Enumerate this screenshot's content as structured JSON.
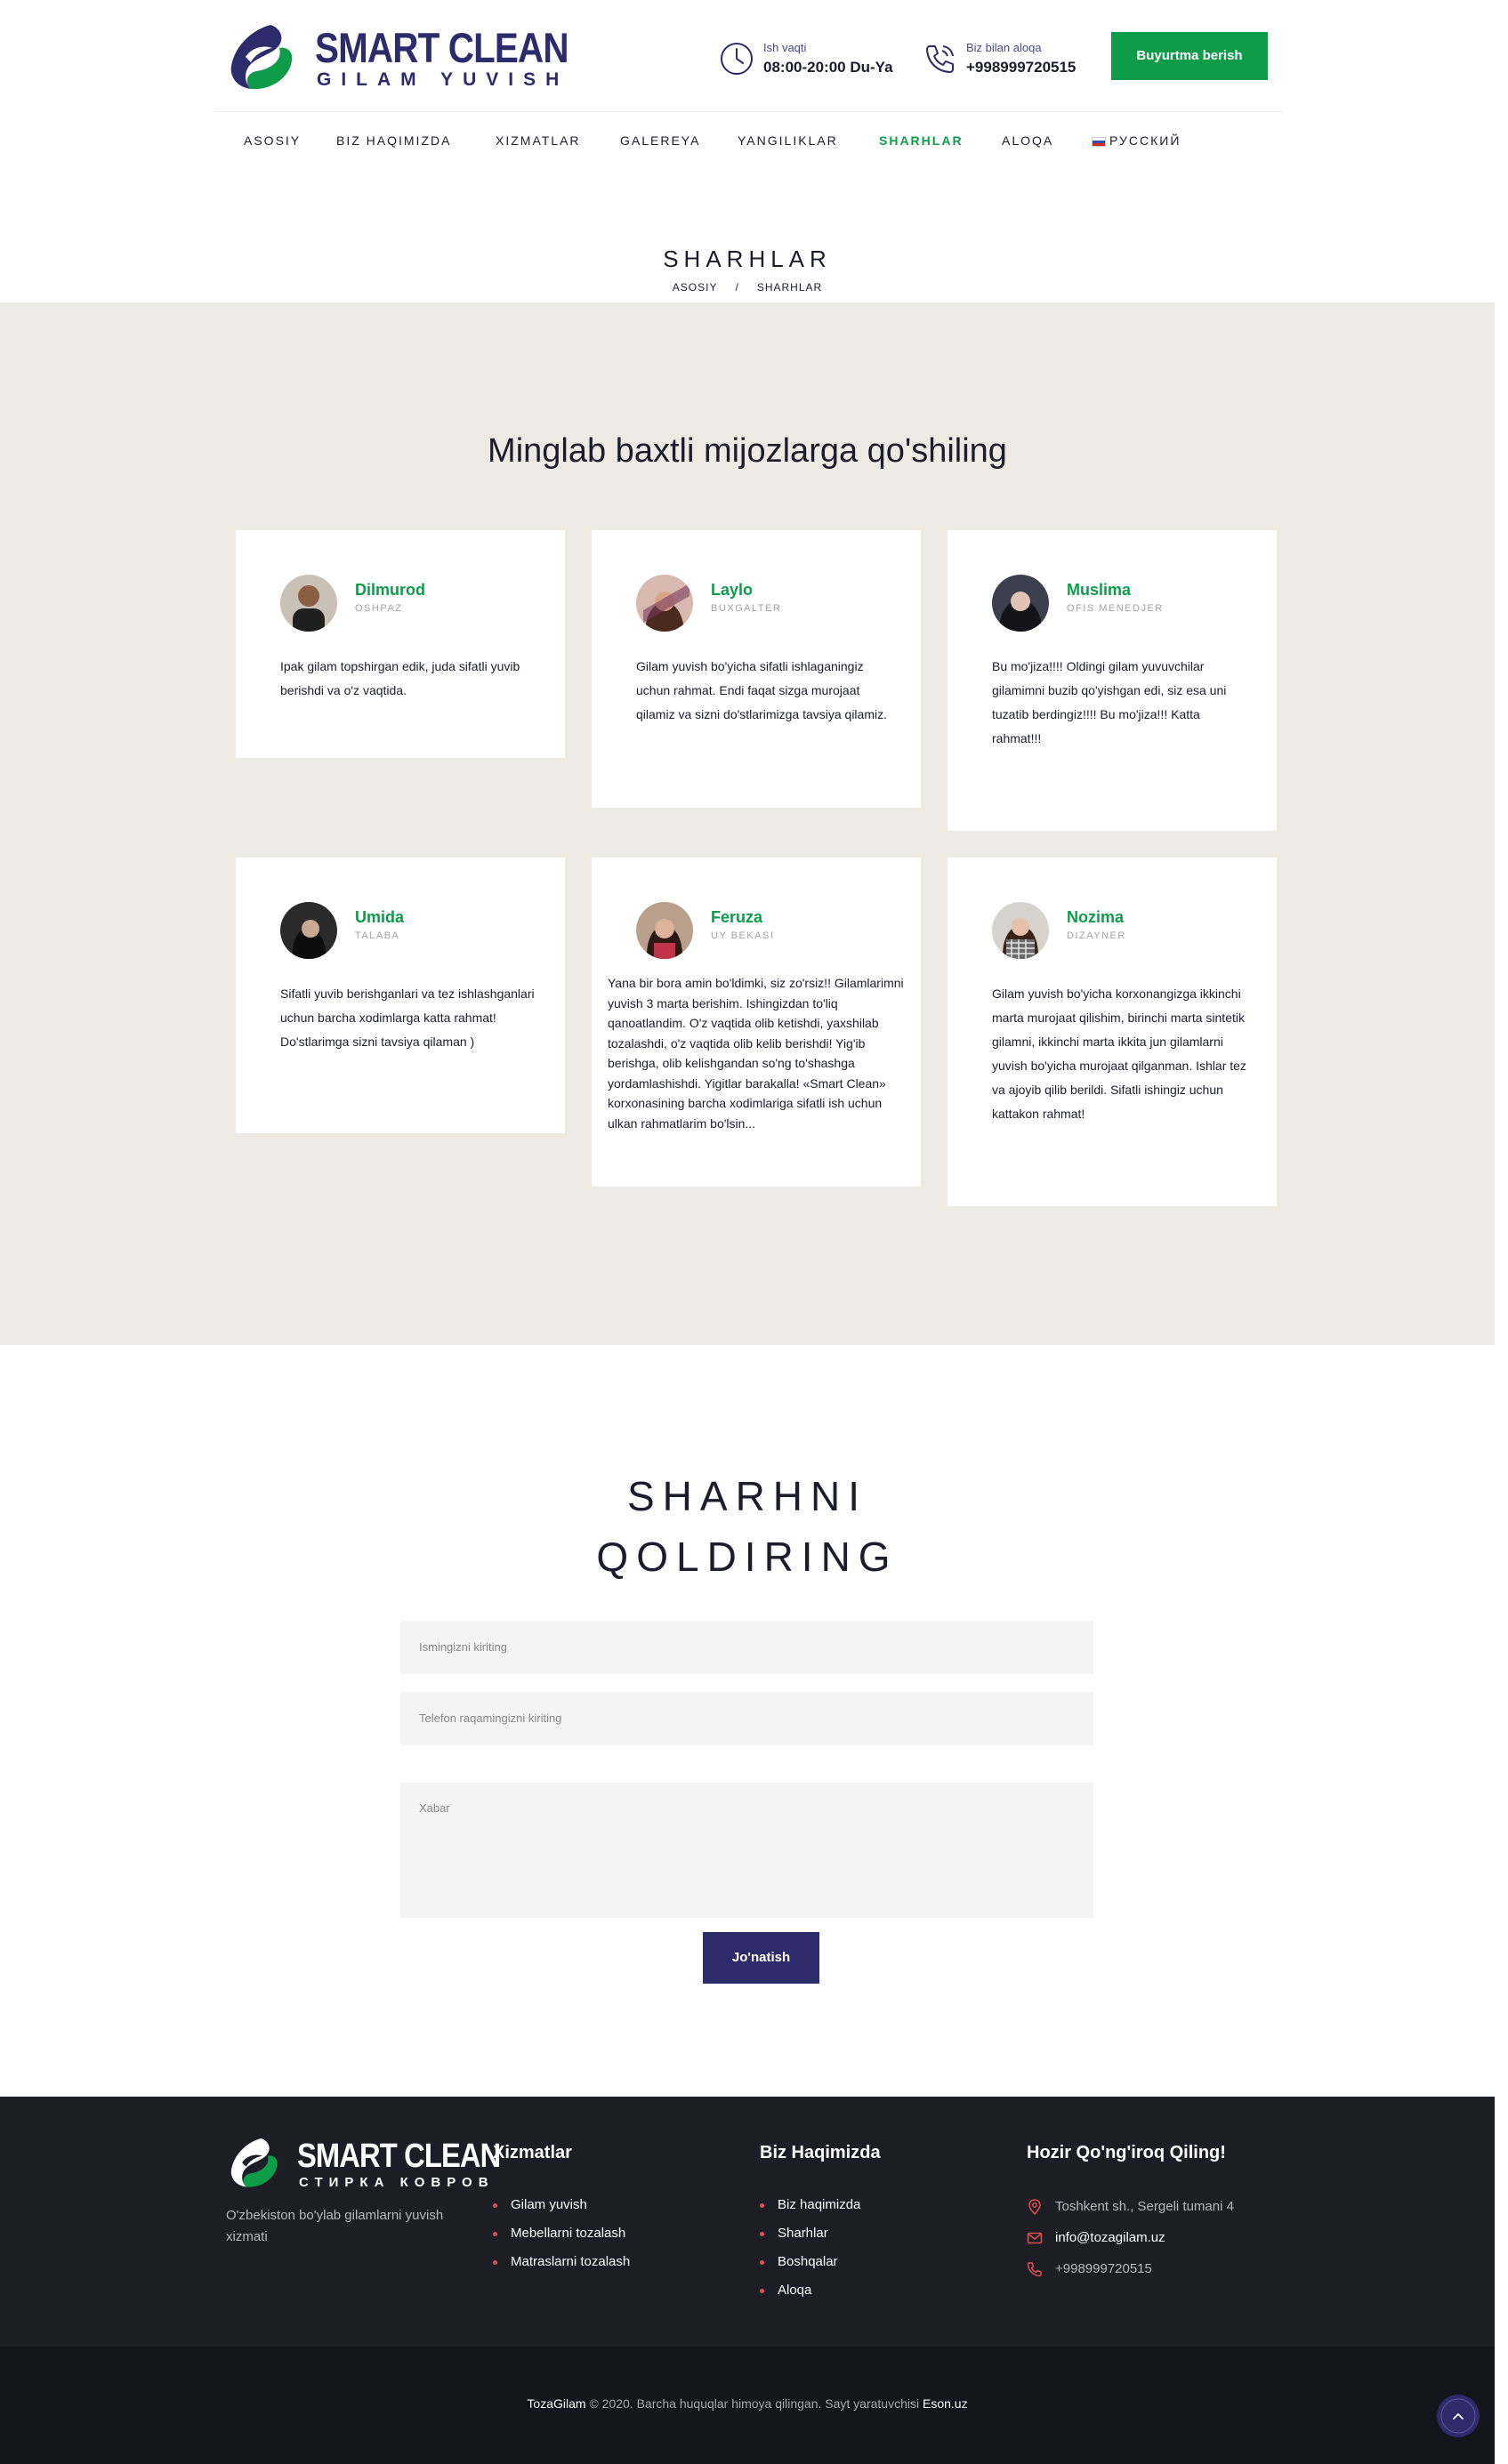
{
  "header": {
    "logo_title": "SMART CLEAN",
    "logo_sub": "GILAM YUVISH",
    "work_hours_label": "Ish vaqti",
    "work_hours_value": "08:00-20:00 Du-Ya",
    "contact_label": "Biz bilan aloqa",
    "contact_value": "+998999720515",
    "order_button": "Buyurtma berish"
  },
  "nav": {
    "items": [
      {
        "label": "ASOSIY"
      },
      {
        "label": "BIZ HAQIMIZDA"
      },
      {
        "label": "XIZMATLAR"
      },
      {
        "label": "GALEREYA"
      },
      {
        "label": "YANGILIKLAR"
      },
      {
        "label": "SHARHLAR"
      },
      {
        "label": "ALOQA"
      },
      {
        "label": "РУССКИЙ"
      }
    ],
    "active": "SHARHLAR"
  },
  "page": {
    "title": "SHARHLAR",
    "breadcrumb_home": "ASOSIY",
    "breadcrumb_sep": "/",
    "breadcrumb_current": "SHARHLAR"
  },
  "reviews": {
    "heading": "Minglab baxtli mijozlarga qo'shiling",
    "items": [
      {
        "name": "Dilmurod",
        "role": "OSHPAZ",
        "text": "Ipak gilam topshirgan edik, juda sifatli yuvib berishdi va o'z vaqtida."
      },
      {
        "name": "Laylo",
        "role": "BUXGALTER",
        "text": "Gilam yuvish bo'yicha sifatli ishlaganingiz uchun rahmat. Endi faqat sizga murojaat qilamiz va sizni do'stlarimizga tavsiya qilamiz."
      },
      {
        "name": "Muslima",
        "role": "OFIS MENEDJER",
        "text": "Bu mo'jiza!!!! Oldingi gilam yuvuvchilar gilamimni buzib qo'yishgan edi, siz esa uni tuzatib berdingiz!!!! Bu mo'jiza!!! Katta rahmat!!!"
      },
      {
        "name": "Umida",
        "role": "TALABA",
        "text": "Sifatli yuvib berishganlari va tez ishlashganlari uchun barcha xodimlarga katta rahmat! Do'stlarimga sizni tavsiya qilaman )"
      },
      {
        "name": "Feruza",
        "role": "UY BEKASI",
        "text": "Yana bir bora amin bo'ldimki, siz zo'rsiz!! Gilamlarimni yuvish 3 marta berishim. Ishingizdan to'liq qanoatlandim. O'z vaqtida olib ketishdi, yaxshilab tozalashdi, o'z vaqtida olib kelib berishdi! Yig'ib berishga, olib kelishgandan so'ng to'shashga yordamlashishdi. Yigitlar barakalla! «Smart Clean» korxonasining barcha xodimlariga sifatli ish uchun ulkan rahmatlarim bo'lsin..."
      },
      {
        "name": "Nozima",
        "role": "DIZAYNER",
        "text": "Gilam yuvish bo'yicha korxonangizga ikkinchi marta murojaat qilishim, birinchi marta sintetik gilamni, ikkinchi marta ikkita jun gilamlarni yuvish bo'yicha murojaat qilganman. Ishlar tez va ajoyib qilib berildi. Sifatli ishingiz uchun kattakon rahmat!"
      }
    ]
  },
  "form": {
    "title_line1": "SHARHNI",
    "title_line2": "QOLDIRING",
    "name_placeholder": "Ismingizni kiriting",
    "phone_placeholder": "Telefon raqamingizni kiriting",
    "message_placeholder": "Xabar",
    "submit": "Jo'natish"
  },
  "footer": {
    "logo_title": "SMART CLEAN",
    "logo_sub": "СТИРКА КОВРОВ",
    "description": "O'zbekiston bo'ylab gilamlarni yuvish xizmati",
    "services_heading": "Xizmatlar",
    "services": [
      "Gilam yuvish",
      "Mebellarni tozalash",
      "Matraslarni tozalash"
    ],
    "about_heading": "Biz Haqimizda",
    "about": [
      "Biz haqimizda",
      "Sharhlar",
      "Boshqalar",
      "Aloqa"
    ],
    "contact_heading": "Hozir Qo'ng'iroq Qiling!",
    "address": "Toshkent sh., Sergeli tumani 4",
    "email": "info@tozagilam.uz",
    "phone": "+998999720515",
    "copyright_brand": "TozaGilam",
    "copyright_text": "© 2020. Barcha huquqlar himoya qilingan. Sayt yaratuvchisi",
    "copyright_author": "Eson.uz"
  },
  "colors": {
    "brand_navy": "#2e2b6b",
    "brand_green": "#0e9c4b",
    "section_bg": "#edeae3",
    "footer_bg": "#1d1d25"
  }
}
